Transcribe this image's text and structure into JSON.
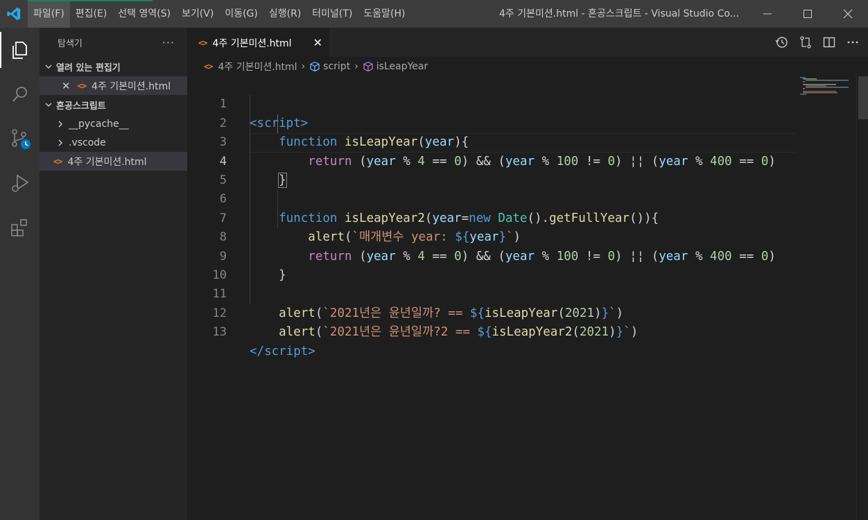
{
  "window": {
    "title": "4주 기본미션.html - 혼공스크립트 - Visual Studio Co...",
    "accent": "#007acc"
  },
  "menu": [
    {
      "label": "파일(F)"
    },
    {
      "label": "편집(E)"
    },
    {
      "label": "선택 영역(S)"
    },
    {
      "label": "보기(V)"
    },
    {
      "label": "이동(G)"
    },
    {
      "label": "실행(R)"
    },
    {
      "label": "터미널(T)"
    },
    {
      "label": "도움말(H)"
    }
  ],
  "activity_bar": [
    "explorer-icon",
    "search-icon",
    "source-control-icon",
    "run-debug-icon",
    "extensions-icon"
  ],
  "sidebar": {
    "title": "탐색기",
    "more": "···",
    "open_editors": {
      "label": "열려 있는 편집기",
      "files": [
        {
          "icon": "<>",
          "name": "4주 기본미션.html"
        }
      ]
    },
    "project": {
      "label": "혼공스크립트",
      "items": [
        {
          "name": "__pycache__",
          "type": "folder"
        },
        {
          "name": ".vscode",
          "type": "folder"
        },
        {
          "name": "4주 기본미션.html",
          "type": "file",
          "icon": "<>"
        }
      ]
    }
  },
  "tab": {
    "icon": "<>",
    "label": "4주 기본미션.html",
    "close": "✕"
  },
  "breadcrumb": {
    "file": "4주 기본미션.html",
    "scope1": "script",
    "scope2": "isLeapYear"
  },
  "editor": {
    "current_line": 4,
    "line_numbers": [
      "1",
      "2",
      "3",
      "4",
      "5",
      "6",
      "7",
      "8",
      "9",
      "10",
      "11",
      "12",
      "13"
    ]
  }
}
